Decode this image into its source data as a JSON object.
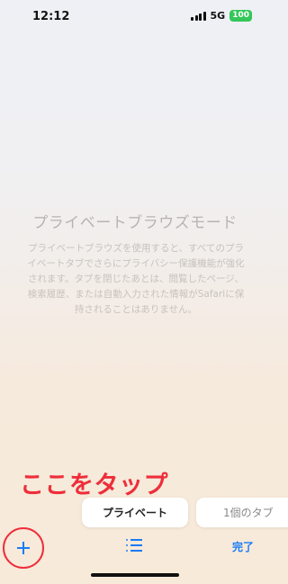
{
  "status_bar": {
    "time": "12:12",
    "network": "5G",
    "battery": "100",
    "icons": [
      "signal-icon",
      "battery-icon"
    ]
  },
  "private_mode": {
    "title": "プライベートブラウズモード",
    "description": "プライベートブラウズを使用すると、すべてのプライベートタブでさらにプライバシー保護機能が強化されます。タブを閉じたあとは、閲覧したページ、検索履歴、または自動入力された情報がSafariに保持されることはありません。"
  },
  "annotation": {
    "text": "ここをタップ",
    "color": "#ee2e3a"
  },
  "toolbar": {
    "segment_private": "プライベート",
    "segment_tabs": "1個のタブ",
    "done_label": "完了",
    "accent_color": "#1a7cf5",
    "icons": [
      "plus-icon",
      "tab-list-icon"
    ]
  }
}
